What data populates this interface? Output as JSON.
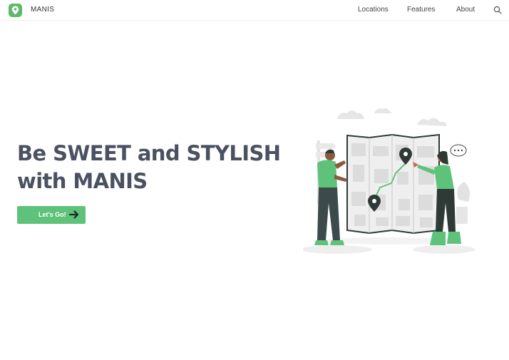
{
  "nav": {
    "brand": "MANIS",
    "links": [
      "Locations",
      "Features",
      "About"
    ],
    "search_icon": "search-icon",
    "logo_icon": "map-pin-icon"
  },
  "hero": {
    "title_line1": "Be SWEET and STYLISH",
    "title_line2": "with MANIS",
    "cta_label": "Let's Go!",
    "cta_icon": "arrow-right-icon",
    "illustration": "people-reading-map-illustration"
  },
  "colors": {
    "accent": "#5fc27a",
    "heading": "#4a5160",
    "logo": "#5fb96b"
  }
}
